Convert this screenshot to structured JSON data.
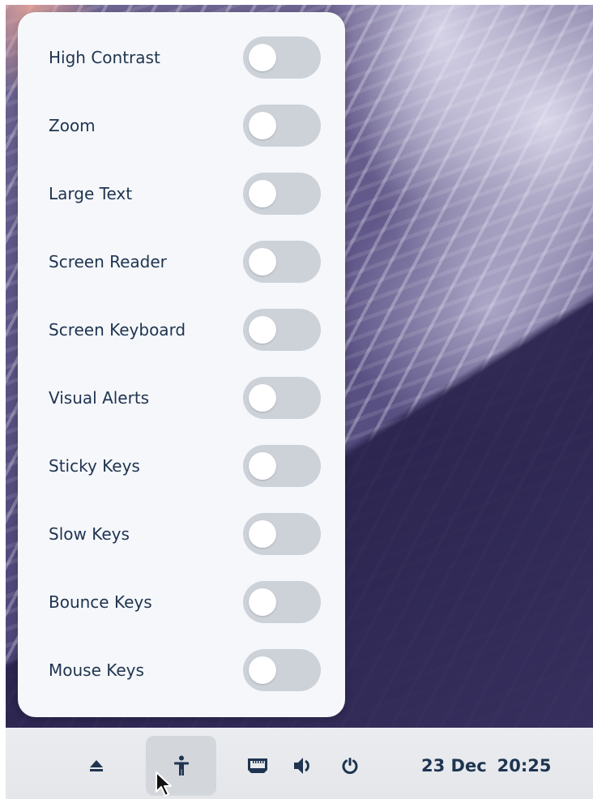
{
  "accessibility_menu": {
    "items": [
      {
        "label": "High Contrast",
        "enabled": false
      },
      {
        "label": "Zoom",
        "enabled": false
      },
      {
        "label": "Large Text",
        "enabled": false
      },
      {
        "label": "Screen Reader",
        "enabled": false
      },
      {
        "label": "Screen Keyboard",
        "enabled": false
      },
      {
        "label": "Visual Alerts",
        "enabled": false
      },
      {
        "label": "Sticky Keys",
        "enabled": false
      },
      {
        "label": "Slow Keys",
        "enabled": false
      },
      {
        "label": "Bounce Keys",
        "enabled": false
      },
      {
        "label": "Mouse Keys",
        "enabled": false
      }
    ]
  },
  "panel": {
    "icons": {
      "eject": "eject-icon",
      "accessibility": "accessibility-icon",
      "network": "wired-network-icon",
      "volume": "volume-icon",
      "power": "power-icon"
    },
    "accessibility_active": true,
    "clock": {
      "date": "23 Dec",
      "time": "20:25"
    }
  },
  "colors": {
    "menu_background": "#f6f7fa",
    "label_text": "#1e3450",
    "toggle_off": "#cdd2d9",
    "panel_background": "#e8eaed",
    "active_button": "#d3d7dc"
  }
}
